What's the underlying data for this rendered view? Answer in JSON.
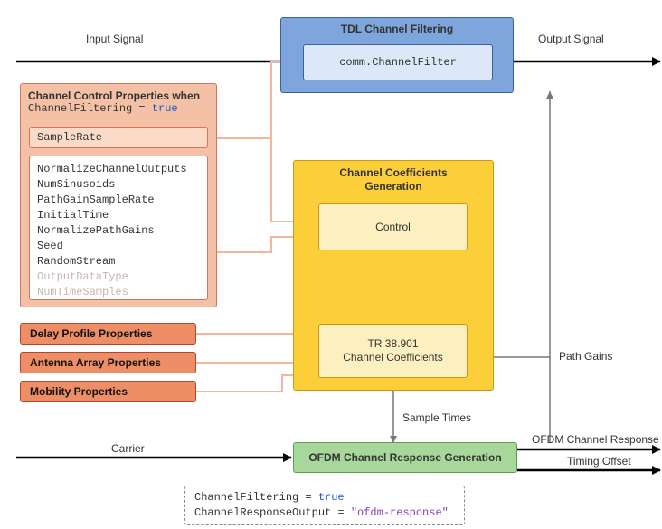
{
  "labels": {
    "input_signal": "Input Signal",
    "output_signal": "Output Signal",
    "tdl_title": "TDL Channel Filtering",
    "tdl_inner": "comm.ChannelFilter",
    "ctrl_title": "Channel Control Properties when",
    "ctrl_subtitle_lhs": "ChannelFiltering = ",
    "ctrl_subtitle_rhs": "true",
    "sample_rate": "SampleRate",
    "prop_list": {
      "p0": "NormalizeChannelOutputs",
      "p1": "NumSinusoids",
      "p2": "PathGainSampleRate",
      "p3": "InitialTime",
      "p4": "NormalizePathGains",
      "p5": "Seed",
      "p6": "RandomStream",
      "p7": "OutputDataType",
      "p8": "NumTimeSamples"
    },
    "delay_profile": "Delay Profile Properties",
    "antenna_array": "Antenna Array Properties",
    "mobility": "Mobility Properties",
    "ccg_title_line1": "Channel Coefficients",
    "ccg_title_line2": "Generation",
    "ccg_control": "Control",
    "ccg_tr_line1": "TR 38.901",
    "ccg_tr_line2": "Channel Coefficients",
    "path_gains": "Path Gains",
    "sample_times": "Sample Times",
    "carrier": "Carrier",
    "ofdm_box": "OFDM Channel Response Generation",
    "ofdm_response": "OFDM Channel Response",
    "timing_offset": "Timing Offset",
    "footer_l1_lhs": "ChannelFiltering = ",
    "footer_l1_rhs": "true",
    "footer_l2_lhs": "ChannelResponseOutput = ",
    "footer_l2_rhs": "\"ofdm-response\""
  },
  "colors": {
    "blue_border": "#3b5ea8",
    "blue_fill": "#7ea6dd",
    "blue_light": "#dce8f7",
    "orange_border": "#d2765a",
    "orange_fill": "#f5c1a6",
    "orange_light": "#f9dbc8",
    "dark_orange_border": "#b2472d",
    "dark_orange_fill": "#ee8e66",
    "yellow_border": "#c79a14",
    "yellow_fill": "#fccf3a",
    "yellow_light": "#fdf0c0",
    "green_border": "#5a9e4f",
    "green_fill": "#a8d79b",
    "arrow_black": "#000",
    "arrow_grey": "#777",
    "arrow_salmon": "#f0b89f"
  }
}
